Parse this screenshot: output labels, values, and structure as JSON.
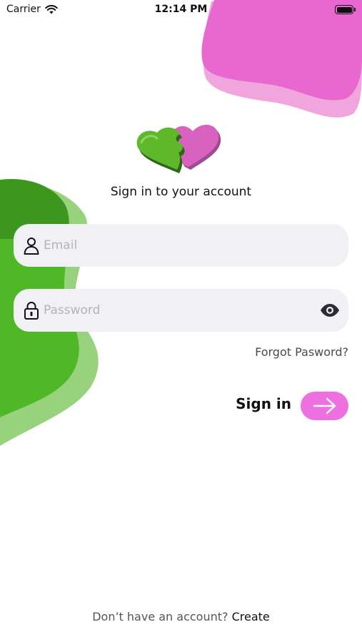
{
  "status_bar": {
    "carrier": "Carrier",
    "time": "12:14 PM",
    "icons": [
      "wifi-icon",
      "battery-icon"
    ]
  },
  "login": {
    "heading": "Sign in to your account",
    "email_placeholder": "Email",
    "password_placeholder": "Password",
    "forgot_label": "Forgot Pasword?",
    "signin_label": "Sign in",
    "icons": [
      "user-icon",
      "lock-icon",
      "eye-icon",
      "arrow-right-icon"
    ]
  },
  "footer": {
    "prompt": "Don’t have an account?",
    "create_label": "Create"
  },
  "colors": {
    "accent_pink": "#ee6fe0",
    "blob_pink": "#e868cf",
    "blob_pink_light": "#f0a6dc",
    "blob_green": "#4fb826",
    "blob_green_light": "#98d27c",
    "field_bg": "#f1f1f5"
  }
}
